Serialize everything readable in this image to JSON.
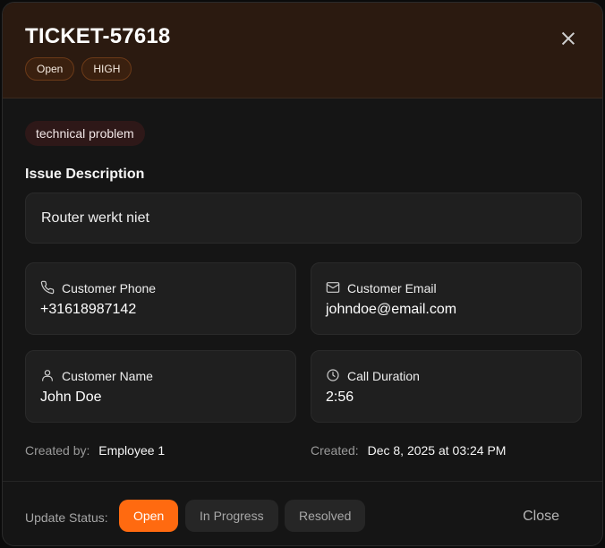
{
  "ticket": {
    "id": "TICKET-57618",
    "badges": [
      "Open",
      "HIGH"
    ],
    "category": "technical problem"
  },
  "issue": {
    "heading": "Issue Description",
    "description": "Router werkt niet"
  },
  "cards": {
    "phone": {
      "label": "Customer Phone",
      "value": "+31618987142",
      "icon": "phone-icon"
    },
    "email": {
      "label": "Customer Email",
      "value": "johndoe@email.com",
      "icon": "mail-icon"
    },
    "name": {
      "label": "Customer Name",
      "value": "John Doe",
      "icon": "user-icon"
    },
    "duration": {
      "label": "Call Duration",
      "value": "2:56",
      "icon": "clock-icon"
    }
  },
  "meta": {
    "created_by_label": "Created by:",
    "created_by": "Employee 1",
    "created_label": "Created:",
    "created": "Dec 8, 2025 at 03:24 PM"
  },
  "footer": {
    "update_label": "Update Status:",
    "statuses": [
      "Open",
      "In Progress",
      "Resolved"
    ],
    "active_status": "Open",
    "close_label": "Close"
  },
  "colors": {
    "accent": "#ff6a10",
    "header_bg": "#2b1a10",
    "card_bg": "#1f1f1f"
  }
}
